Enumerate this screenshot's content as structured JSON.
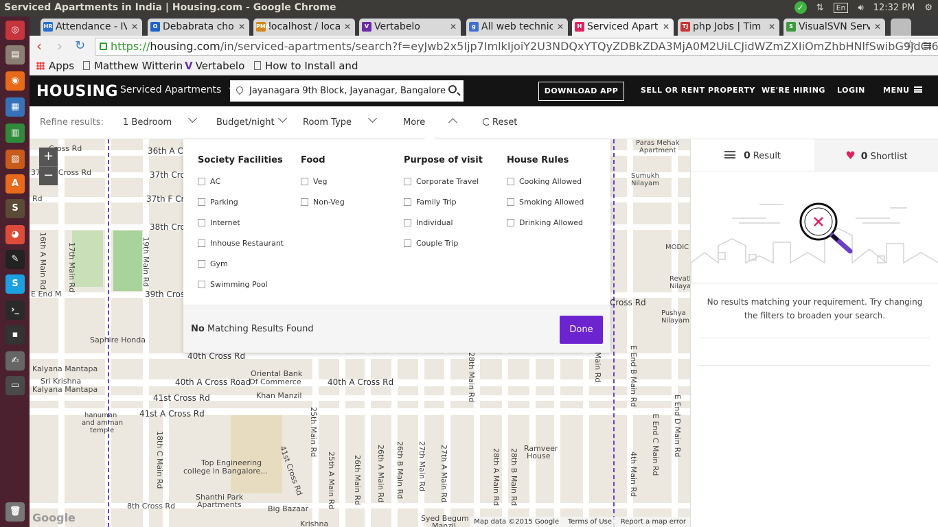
{
  "window_title": "Serviced Apartments in India | Housing.com - Google Chrome",
  "os_tray": {
    "lang": "En",
    "time": "12:32 PM"
  },
  "tabs": [
    {
      "label": "Attendance - IV",
      "favicon": "HR",
      "color": "#2a6fd1"
    },
    {
      "label": "Debabrata cho",
      "favicon": "O",
      "color": "#1c64c8"
    },
    {
      "label": "localhost / loca",
      "favicon": "PMA",
      "color": "#d4881c"
    },
    {
      "label": "Vertabelo",
      "favicon": "V",
      "color": "#6a2ca8"
    },
    {
      "label": "All web technic",
      "favicon": "g",
      "color": "#3f6fd0"
    },
    {
      "label": "Serviced Apart",
      "favicon": "H",
      "color": "#e0235f"
    },
    {
      "label": "php Jobs | Tim",
      "favicon": "TJ",
      "color": "#c33"
    },
    {
      "label": "VisualSVN Serv",
      "favicon": "S",
      "color": "#3c9a3c"
    }
  ],
  "address": {
    "scheme": "https://",
    "host": "housing.com",
    "path": "/in/serviced-apartments/search?f=eyJwb2x5Ijp7ImlkIjoiY2U3NDQxYTQyZDBkZDA3MjA0M2UiLCJidWZmZXIiOmZhbHNlfSwibG9jdCI6InBvbHl"
  },
  "bookmarks": [
    "Apps",
    "Matthew Witterin",
    "Vertabelo",
    "How to Install and"
  ],
  "header": {
    "logo": "HOUSING",
    "city": "Serviced Apartments",
    "search_value": "Jayanagara 9th Block, Jayanagar, Bangalore",
    "download": "DOWNLOAD APP",
    "sell": "SELL OR RENT PROPERTY",
    "hiring": "WE'RE HIRING",
    "login": "LOGIN",
    "menu": "MENU"
  },
  "refine": {
    "label": "Refine results:",
    "bedroom": "1 Bedroom",
    "budget": "Budget/night",
    "room_type": "Room Type",
    "more": "More",
    "reset": "Reset"
  },
  "more_panel": {
    "columns": [
      {
        "title": "Society Facilities",
        "options": [
          "AC",
          "Parking",
          "Internet",
          "Inhouse Restaurant",
          "Gym",
          "Swimming Pool"
        ]
      },
      {
        "title": "Food",
        "options": [
          "Veg",
          "Non-Veg"
        ]
      },
      {
        "title": "Purpose of visit",
        "options": [
          "Corporate Travel",
          "Family Trip",
          "Individual",
          "Couple Trip"
        ]
      },
      {
        "title": "House Rules",
        "options": [
          "Cooking Allowed",
          "Smoking Allowed",
          "Drinking Allowed"
        ]
      }
    ],
    "no_word": "No",
    "no_rest": " Matching Results Found",
    "done": "Done"
  },
  "results": {
    "count": "0",
    "count_label": "Result",
    "shortlist_count": "0",
    "shortlist_label": "Shortlist",
    "empty_message": "No results matching your requirement. Try changing the filters to broaden your search."
  },
  "map": {
    "zoom_in": "+",
    "zoom_out": "−",
    "google": "Google",
    "footer": [
      "Map data ©2015 Google",
      "Terms of Use",
      "Report a map error"
    ],
    "labels": [
      "36th A Cr",
      "37th Cros",
      "37th F Cro",
      "38th Cros",
      "39th Cros",
      "40th Cross Rd",
      "40th A Cross Road",
      "41st Cross Rd",
      "41st A Cross Rd",
      "8th Cross Rd",
      "Saphire Honda",
      "Kalyana Mantapa",
      "Sri Krishna",
      "Kalyana Mantapa",
      "Oriental Bank",
      "Of Commerce",
      "Khan Manzil",
      "40th A Cross Rd",
      "Top Engineering",
      "college in Bangalore...",
      "Shanthi Park",
      "Apartments",
      "Big Bazaar",
      "Krishna",
      "Syed Begum",
      "Manzil",
      "Ramveer",
      "House",
      "Paras Mehak",
      "Apartment",
      "Sumukh",
      "Nilayam",
      "MODIC",
      "Revath",
      "Nilayar",
      "Pushya",
      "Nilayam",
      "Cross Rd",
      "hanuman",
      "and amman",
      "temple",
      "19th Main Rd",
      "17th Main Rd",
      "16th A Main Rd",
      "18th C Main Rd",
      "25th Main Rd",
      "25th A Main Rd",
      "26th Main Rd",
      "26th A Main Rd",
      "26th B Main Rd",
      "27th Main Rd",
      "27th A Main Rd",
      "28th Main Rd",
      "28th A Main Rd",
      "28th B Main Rd",
      "E End B Main Rd",
      "E End C Main Rd",
      "E End D Main Rd",
      "4th Main Rd",
      "41st Cross Rd",
      "8th Main Rd",
      "A Cross Rd",
      "Cross Rd",
      "37th A Cross Rd",
      "Rd",
      "E End M",
      "Main Rd"
    ]
  },
  "colors": {
    "accent": "#6c24d1",
    "heart": "#e0235f",
    "header_bg": "#141414"
  }
}
